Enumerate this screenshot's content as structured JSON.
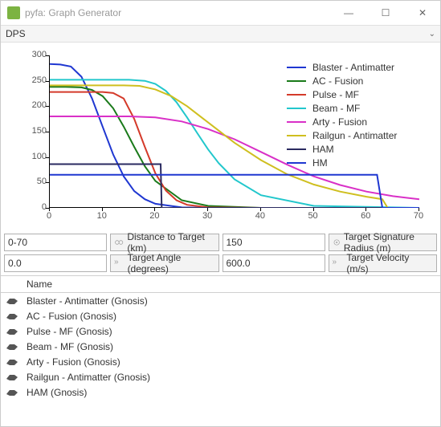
{
  "window": {
    "title": "pyfa: Graph Generator",
    "minimize": "—",
    "maximize": "☐",
    "close": "✕"
  },
  "dps_label": "DPS",
  "chart_data": {
    "type": "line",
    "xlabel": "",
    "ylabel": "",
    "xlim": [
      0,
      70
    ],
    "ylim": [
      0,
      300
    ],
    "xticks": [
      0,
      10,
      20,
      30,
      40,
      50,
      60,
      70
    ],
    "yticks": [
      0,
      50,
      100,
      150,
      200,
      250,
      300
    ],
    "series": [
      {
        "name": "Blaster - Antimatter",
        "color": "#1f37d1",
        "x": [
          0,
          2,
          4,
          6,
          8,
          10,
          12,
          14,
          16,
          18,
          20,
          25,
          30,
          40,
          70
        ],
        "y": [
          283,
          282,
          278,
          258,
          215,
          160,
          105,
          62,
          33,
          17,
          8,
          1,
          0,
          0,
          0
        ]
      },
      {
        "name": "AC - Fusion",
        "color": "#1a7a1a",
        "x": [
          0,
          3,
          6,
          8,
          10,
          12,
          14,
          16,
          18,
          20,
          25,
          30,
          40,
          70
        ],
        "y": [
          238,
          238,
          237,
          232,
          220,
          196,
          160,
          120,
          82,
          53,
          15,
          4,
          0,
          0
        ]
      },
      {
        "name": "Pulse - MF",
        "color": "#d43a2a",
        "x": [
          0,
          4,
          8,
          10,
          12,
          14,
          16,
          18,
          20,
          22,
          24,
          26,
          30,
          40,
          70
        ],
        "y": [
          228,
          228,
          228,
          228,
          226,
          215,
          175,
          120,
          68,
          34,
          15,
          6,
          1,
          0,
          0
        ]
      },
      {
        "name": "Beam - MF",
        "color": "#22c7cc",
        "x": [
          0,
          5,
          10,
          15,
          18,
          20,
          22,
          24,
          26,
          28,
          30,
          32,
          35,
          40,
          50,
          70
        ],
        "y": [
          252,
          252,
          252,
          252,
          250,
          244,
          230,
          208,
          178,
          146,
          115,
          88,
          56,
          25,
          4,
          0
        ]
      },
      {
        "name": "Arty - Fusion",
        "color": "#d930c7",
        "x": [
          0,
          10,
          15,
          20,
          25,
          30,
          35,
          40,
          45,
          50,
          55,
          60,
          65,
          70
        ],
        "y": [
          180,
          180,
          180,
          178,
          170,
          155,
          135,
          110,
          85,
          62,
          45,
          32,
          23,
          17
        ]
      },
      {
        "name": "Railgun - Antimatter",
        "color": "#cfbf1f",
        "x": [
          0,
          5,
          10,
          14,
          17,
          20,
          23,
          26,
          30,
          35,
          40,
          45,
          50,
          55,
          60,
          63,
          64,
          70
        ],
        "y": [
          241,
          241,
          241,
          241,
          240,
          233,
          220,
          200,
          168,
          128,
          94,
          66,
          46,
          32,
          22,
          17,
          0,
          0
        ]
      },
      {
        "name": "HAM",
        "color": "#2a2a60",
        "x": [
          0,
          10,
          15,
          20,
          21,
          21.2,
          70
        ],
        "y": [
          86,
          86,
          86,
          86,
          86,
          0,
          0
        ]
      },
      {
        "name": "HM",
        "color": "#1f37d1",
        "x": [
          0,
          10,
          20,
          30,
          40,
          50,
          60,
          62,
          63,
          70
        ],
        "y": [
          65,
          65,
          65,
          65,
          65,
          65,
          65,
          65,
          0,
          0
        ]
      }
    ]
  },
  "inputs": {
    "distance_value": "0-70",
    "distance_label": "Distance to Target (km)",
    "sig_value": "150",
    "sig_label": "Target Signature Radius (m)",
    "angle_value": "0.0",
    "angle_label": "Target Angle (degrees)",
    "vel_value": "600.0",
    "vel_label": "Target Velocity (m/s)"
  },
  "list_header": "Name",
  "fits": [
    {
      "name": "Blaster - Antimatter (Gnosis)"
    },
    {
      "name": "AC - Fusion (Gnosis)"
    },
    {
      "name": "Pulse - MF (Gnosis)"
    },
    {
      "name": "Beam - MF (Gnosis)"
    },
    {
      "name": "Arty - Fusion (Gnosis)"
    },
    {
      "name": "Railgun - Antimatter (Gnosis)"
    },
    {
      "name": "HAM (Gnosis)"
    }
  ]
}
